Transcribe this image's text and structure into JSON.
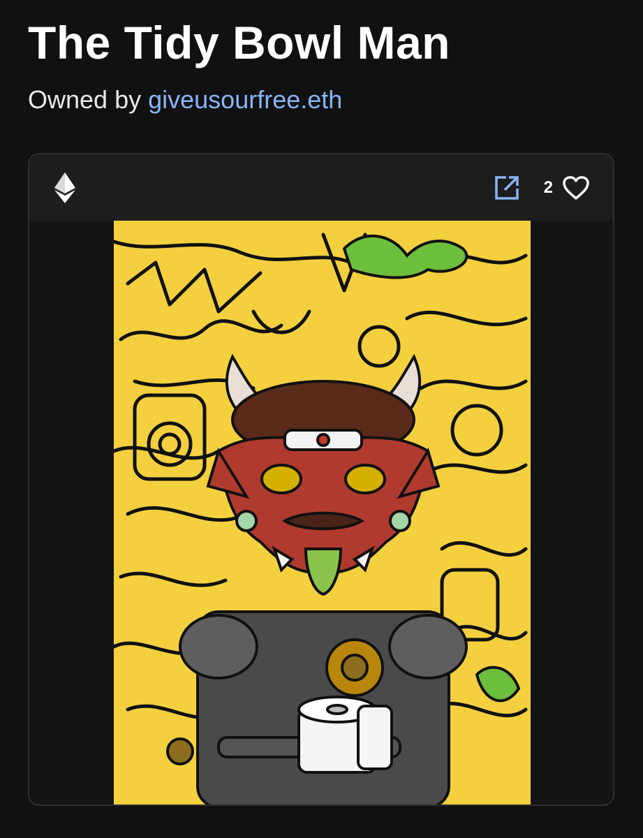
{
  "page": {
    "title": "The Tidy Bowl Man",
    "owned_by_prefix": "Owned by",
    "owner": "giveusourfree.eth"
  },
  "card": {
    "chain_icon": "ethereum-icon",
    "external_link_icon": "external-link-icon",
    "like_count": "2",
    "like_icon": "heart-outline-icon",
    "artwork_alt": "The Tidy Bowl Man"
  },
  "colors": {
    "background": "#111111",
    "card_header": "#1d1d1d",
    "link": "#8ab4f8",
    "artwork_background": "#f4d03f"
  }
}
